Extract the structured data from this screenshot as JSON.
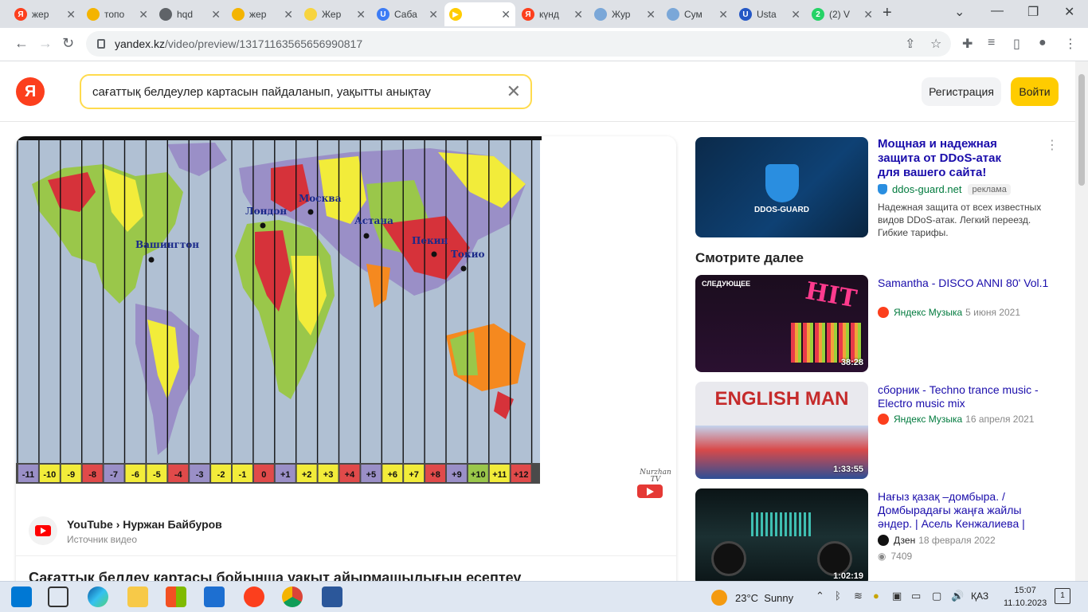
{
  "browser": {
    "tabs": [
      {
        "label": "жер",
        "favicon": "yandex-icon",
        "color": "#fc3f1d",
        "glyph": "Я"
      },
      {
        "label": "топо",
        "favicon": "image-icon",
        "color": "#f4b400",
        "glyph": ""
      },
      {
        "label": "hqd",
        "favicon": "globe-icon",
        "color": "#5f6368",
        "glyph": ""
      },
      {
        "label": "жер",
        "favicon": "image-icon",
        "color": "#f4b400",
        "glyph": ""
      },
      {
        "label": "Жер",
        "favicon": "pencil-icon",
        "color": "#f7d43f",
        "glyph": ""
      },
      {
        "label": "Саба",
        "favicon": "u-icon",
        "color": "#3d7cf5",
        "glyph": "U"
      },
      {
        "label": "",
        "favicon": "yandex-video-icon",
        "color": "#ffcc00",
        "glyph": "▶"
      },
      {
        "label": "күнд",
        "favicon": "yandex-icon",
        "color": "#fc3f1d",
        "glyph": "Я"
      },
      {
        "label": "Жур",
        "favicon": "bulb-icon",
        "color": "#7aa7d8",
        "glyph": ""
      },
      {
        "label": "Сум",
        "favicon": "bulb-icon",
        "color": "#7aa7d8",
        "glyph": ""
      },
      {
        "label": "Usta",
        "favicon": "u-icon",
        "color": "#2457c5",
        "glyph": "U"
      },
      {
        "label": "(2) V",
        "favicon": "whatsapp-icon",
        "color": "#25d366",
        "glyph": "2"
      }
    ],
    "active_tab": 6,
    "url_domain": "yandex.kz",
    "url_path": "/video/preview/13171163565656990817"
  },
  "header": {
    "logo": "Я",
    "search_query": "сағаттық белдеулер картасын пайдаланып, уақытты анықтау",
    "register_label": "Регистрация",
    "login_label": "Войти"
  },
  "video": {
    "cities": [
      "Вашингтон",
      "Лондон",
      "Москва",
      "Астана",
      "Пекин",
      "Токио"
    ],
    "zones": [
      "-11",
      "-10",
      "-9",
      "-8",
      "-7",
      "-6",
      "-5",
      "-4",
      "-3",
      "-2",
      "-1",
      "0",
      "+1",
      "+2",
      "+3",
      "+4",
      "+5",
      "+6",
      "+7",
      "+8",
      "+9",
      "+10",
      "+11",
      "+12"
    ],
    "zone_colors": [
      "#9a8fc7",
      "#f2ec3a",
      "#f2ec3a",
      "#e04a4a",
      "#9a8fc7",
      "#f2ec3a",
      "#f2ec3a",
      "#e04a4a",
      "#9a8fc7",
      "#f2ec3a",
      "#f2ec3a",
      "#e04a4a",
      "#9a8fc7",
      "#f2ec3a",
      "#f2ec3a",
      "#e04a4a",
      "#9a8fc7",
      "#f2ec3a",
      "#f2ec3a",
      "#e04a4a",
      "#9a8fc7",
      "#9ac74a",
      "#f2ec3a",
      "#e04a4a"
    ],
    "watermark": "Nurzhan TV",
    "source_name": "YouTube › Нуржан Байбуров",
    "source_sub": "Источник видео",
    "title": "Сағаттық белдеу картасы бойынша уақыт айырмашылығын есептеу"
  },
  "ad": {
    "logo_text": "DDOS-GUARD",
    "title": "Мощная и надежная защита от DDoS-атак для вашего сайта!",
    "domain": "ddos-guard.net",
    "badge": "реклама",
    "text": "Надежная защита от всех известных видов DDoS-атак. Легкий переезд. Гибкие тарифы."
  },
  "see_more": "Смотрите далее",
  "recommendations": [
    {
      "title": "Samantha - DISCO ANNI 80' Vol.1",
      "source": "Яндекс Музыка",
      "date": "5 июня 2021",
      "duration": "38:28",
      "next_label": "СЛЕДУЮЩЕЕ",
      "views": ""
    },
    {
      "title": "сборник - Techno trance music - Electro music mix",
      "source": "Яндекс Музыка",
      "date": "16 апреля 2021",
      "duration": "1:33:55",
      "thumb_text": "ENGLISH MAN",
      "views": ""
    },
    {
      "title": "Нағыз қазақ –домбыра. / Домбырадағы жаңға жайлы әндер. | Асель Кенжалиева |",
      "source": "Дзен",
      "date": "18 февраля 2022",
      "duration": "1:02:19",
      "views": "7409"
    }
  ],
  "taskbar": {
    "weather_temp": "23°C",
    "weather_text": "Sunny",
    "lang": "ҚАЗ",
    "time": "15:07",
    "date": "11.10.2023",
    "notifications": "1"
  }
}
